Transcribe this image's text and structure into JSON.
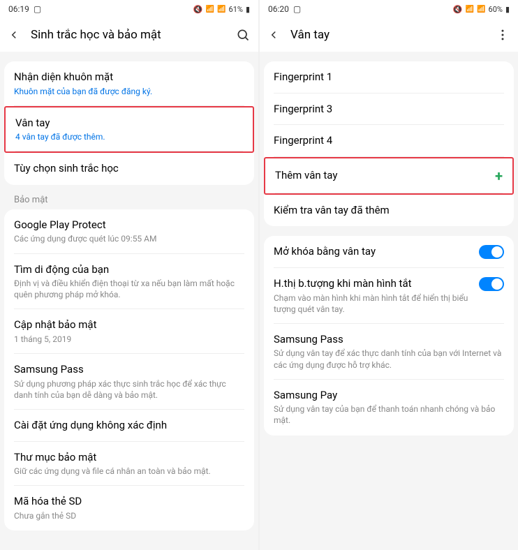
{
  "left": {
    "status": {
      "time": "06:19",
      "battery": "61%"
    },
    "header": {
      "title": "Sinh trắc học và bảo mật"
    },
    "group1": [
      {
        "title": "Nhận diện khuôn mặt",
        "sub": "Khuôn mặt của bạn đã được đăng ký.",
        "blue": true,
        "hl": false
      },
      {
        "title": "Vân tay",
        "sub": "4 vân tay đã được thêm.",
        "blue": true,
        "hl": true
      },
      {
        "title": "Tùy chọn sinh trắc học",
        "sub": "",
        "blue": false,
        "hl": false
      }
    ],
    "section_label": "Bảo mật",
    "group2": [
      {
        "title": "Google Play Protect",
        "sub": "Các ứng dụng được quét lúc 09:55 AM"
      },
      {
        "title": "Tìm di động của bạn",
        "sub": "Định vị và điều khiển điện thoại từ xa nếu bạn làm mất hoặc quên phương pháp mở khóa."
      },
      {
        "title": "Cập nhật bảo mật",
        "sub": "1 tháng 5, 2019"
      },
      {
        "title": "Samsung Pass",
        "sub": "Sử dụng phương pháp xác thực sinh trắc học để xác thực danh tính của bạn dễ dàng và bảo mật."
      },
      {
        "title": "Cài đặt ứng dụng không xác định",
        "sub": ""
      },
      {
        "title": "Thư mục bảo mật",
        "sub": "Giữ các ứng dụng và file cá nhân an toàn và bảo mật."
      },
      {
        "title": "Mã hóa thẻ SD",
        "sub": "Chưa gắn thẻ SD"
      }
    ]
  },
  "right": {
    "status": {
      "time": "06:20",
      "battery": "60%"
    },
    "header": {
      "title": "Vân tay"
    },
    "fingerprints": [
      {
        "label": "Fingerprint 1"
      },
      {
        "label": "Fingerprint 3"
      },
      {
        "label": "Fingerprint 4"
      }
    ],
    "add_label": "Thêm vân tay",
    "check_label": "Kiểm tra vân tay đã thêm",
    "settings": [
      {
        "title": "Mở khóa bằng vân tay",
        "sub": "",
        "toggle": true
      },
      {
        "title": "H.thị b.tượng khi màn hình tắt",
        "sub": "Chạm vào màn hình khi màn hình tắt để hiển thị biểu tượng quét vân tay.",
        "toggle": true
      },
      {
        "title": "Samsung Pass",
        "sub": "Sử dụng vân tay để xác thực danh tính của bạn với Internet và các ứng dụng được hỗ trợ khác.",
        "toggle": false
      },
      {
        "title": "Samsung Pay",
        "sub": "Sử dụng vân tay của bạn để thanh toán nhanh chóng và bảo mật.",
        "toggle": false
      }
    ]
  }
}
